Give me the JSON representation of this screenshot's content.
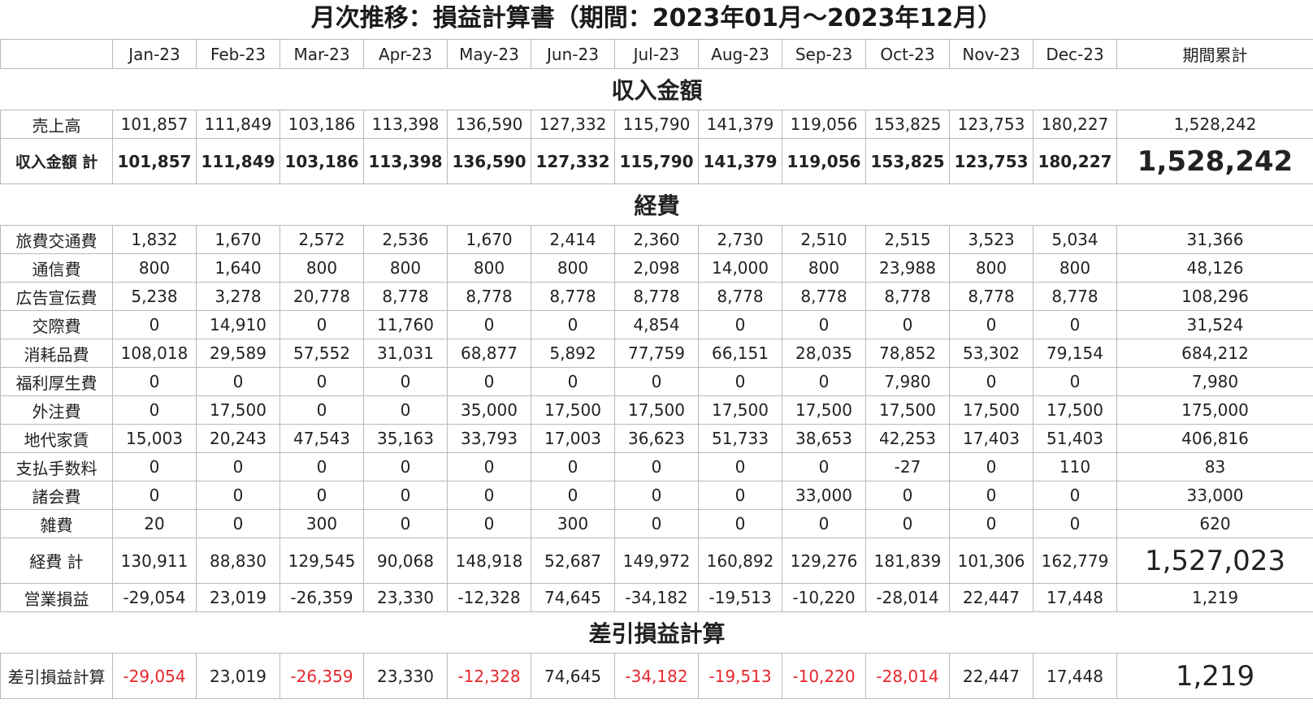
{
  "title": "月次推移：損益計算書（期間：2023年01月～2023年12月）",
  "columns": [
    "Jan-23",
    "Feb-23",
    "Mar-23",
    "Apr-23",
    "May-23",
    "Jun-23",
    "Jul-23",
    "Aug-23",
    "Sep-23",
    "Oct-23",
    "Nov-23",
    "Dec-23",
    "期間累計"
  ],
  "sections": {
    "income": "収入金額",
    "expenses": "経費",
    "diff": "差引損益計算"
  },
  "income_rows": [
    {
      "label": "売上高",
      "values": [
        "101,857",
        "111,849",
        "103,186",
        "113,398",
        "136,590",
        "127,332",
        "115,790",
        "141,379",
        "119,056",
        "153,825",
        "123,753",
        "180,227"
      ],
      "total": "1,528,242"
    }
  ],
  "income_total": {
    "label": "収入金額 計",
    "values": [
      "101,857",
      "111,849",
      "103,186",
      "113,398",
      "136,590",
      "127,332",
      "115,790",
      "141,379",
      "119,056",
      "153,825",
      "123,753",
      "180,227"
    ],
    "total": "1,528,242"
  },
  "expense_rows": [
    {
      "label": "旅費交通費",
      "values": [
        "1,832",
        "1,670",
        "2,572",
        "2,536",
        "1,670",
        "2,414",
        "2,360",
        "2,730",
        "2,510",
        "2,515",
        "3,523",
        "5,034"
      ],
      "total": "31,366"
    },
    {
      "label": "通信費",
      "values": [
        "800",
        "1,640",
        "800",
        "800",
        "800",
        "800",
        "2,098",
        "14,000",
        "800",
        "23,988",
        "800",
        "800"
      ],
      "total": "48,126"
    },
    {
      "label": "広告宣伝費",
      "values": [
        "5,238",
        "3,278",
        "20,778",
        "8,778",
        "8,778",
        "8,778",
        "8,778",
        "8,778",
        "8,778",
        "8,778",
        "8,778",
        "8,778"
      ],
      "total": "108,296"
    },
    {
      "label": "交際費",
      "values": [
        "0",
        "14,910",
        "0",
        "11,760",
        "0",
        "0",
        "4,854",
        "0",
        "0",
        "0",
        "0",
        "0"
      ],
      "total": "31,524"
    },
    {
      "label": "消耗品費",
      "values": [
        "108,018",
        "29,589",
        "57,552",
        "31,031",
        "68,877",
        "5,892",
        "77,759",
        "66,151",
        "28,035",
        "78,852",
        "53,302",
        "79,154"
      ],
      "total": "684,212"
    },
    {
      "label": "福利厚生費",
      "values": [
        "0",
        "0",
        "0",
        "0",
        "0",
        "0",
        "0",
        "0",
        "0",
        "7,980",
        "0",
        "0"
      ],
      "total": "7,980"
    },
    {
      "label": "外注費",
      "values": [
        "0",
        "17,500",
        "0",
        "0",
        "35,000",
        "17,500",
        "17,500",
        "17,500",
        "17,500",
        "17,500",
        "17,500",
        "17,500"
      ],
      "total": "175,000"
    },
    {
      "label": "地代家賃",
      "values": [
        "15,003",
        "20,243",
        "47,543",
        "35,163",
        "33,793",
        "17,003",
        "36,623",
        "51,733",
        "38,653",
        "42,253",
        "17,403",
        "51,403"
      ],
      "total": "406,816"
    },
    {
      "label": "支払手数料",
      "values": [
        "0",
        "0",
        "0",
        "0",
        "0",
        "0",
        "0",
        "0",
        "0",
        "-27",
        "0",
        "110"
      ],
      "total": "83"
    },
    {
      "label": "諸会費",
      "values": [
        "0",
        "0",
        "0",
        "0",
        "0",
        "0",
        "0",
        "0",
        "33,000",
        "0",
        "0",
        "0"
      ],
      "total": "33,000"
    },
    {
      "label": "雑費",
      "values": [
        "20",
        "0",
        "300",
        "0",
        "0",
        "300",
        "0",
        "0",
        "0",
        "0",
        "0",
        "0"
      ],
      "total": "620"
    }
  ],
  "expense_total": {
    "label": "経費 計",
    "values": [
      "130,911",
      "88,830",
      "129,545",
      "90,068",
      "148,918",
      "52,687",
      "149,972",
      "160,892",
      "129,276",
      "181,839",
      "101,306",
      "162,779"
    ],
    "total": "1,527,023"
  },
  "operating": {
    "label": "営業損益",
    "values": [
      "-29,054",
      "23,019",
      "-26,359",
      "23,330",
      "-12,328",
      "74,645",
      "-34,182",
      "-19,513",
      "-10,220",
      "-28,014",
      "22,447",
      "17,448"
    ],
    "total": "1,219"
  },
  "diff_row": {
    "label": "差引損益計算",
    "values": [
      "-29,054",
      "23,019",
      "-26,359",
      "23,330",
      "-12,328",
      "74,645",
      "-34,182",
      "-19,513",
      "-10,220",
      "-28,014",
      "22,447",
      "17,448"
    ],
    "total": "1,219"
  },
  "colors": {
    "negative": "#e8262d",
    "text": "#222222",
    "grid": "#b9b9b9"
  }
}
